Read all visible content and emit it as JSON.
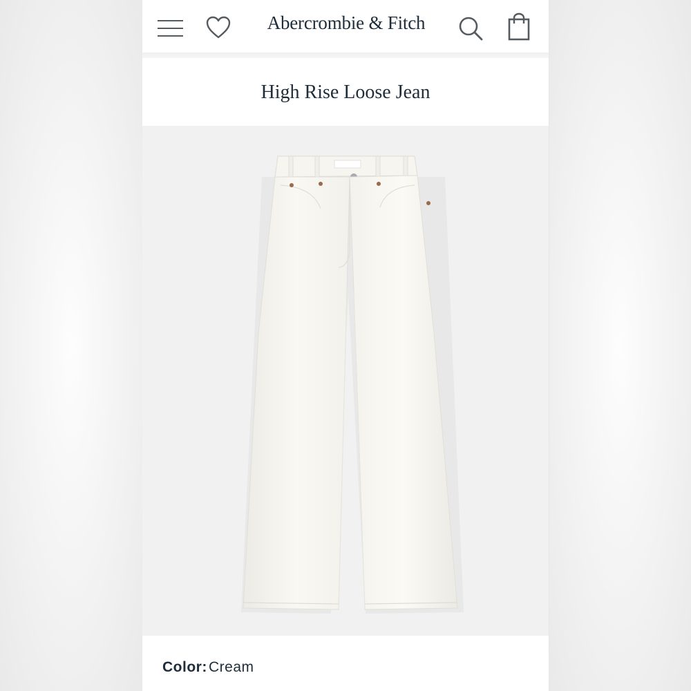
{
  "header": {
    "brand": "Abercrombie & Fitch",
    "icons": {
      "menu": "hamburger-menu-icon",
      "wishlist": "heart-icon",
      "search": "search-icon",
      "bag": "shopping-bag-icon"
    }
  },
  "product": {
    "title": "High Rise Loose Jean",
    "image_alt": "cream high rise loose jeans",
    "color_label": "Color:",
    "color_value": "Cream"
  },
  "colors": {
    "brand_navy": "#1f2d3a",
    "image_background": "#f1f1f1",
    "denim_cream": "#f8f6f0"
  }
}
